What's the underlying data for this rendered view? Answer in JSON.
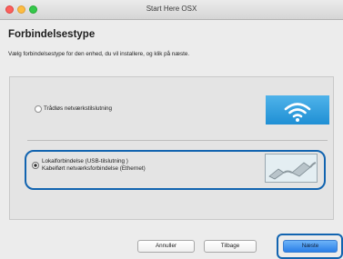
{
  "window": {
    "title": "Start Here OSX"
  },
  "page": {
    "heading": "Forbindelsestype",
    "instruction": "Vælg forbindelsestype for den enhed, du vil installere, og klik på næste."
  },
  "options": [
    {
      "label": "Trådløs netværkstilslutning",
      "selected": false,
      "icon": "wifi-icon"
    },
    {
      "label_line1": "Lokalforbindelse (USB-tilslutning )",
      "label_line2": "Kabelført netværksforbindelse (Ethernet)",
      "selected": true,
      "icon": "usb-ethernet-cable-icon"
    }
  ],
  "buttons": {
    "cancel": "Annuller",
    "back": "Tilbage",
    "next": "Næste"
  },
  "colors": {
    "highlight": "#1264b0",
    "primary_button": "#2a7fe8",
    "wifi_bg": "#2a9de0"
  }
}
